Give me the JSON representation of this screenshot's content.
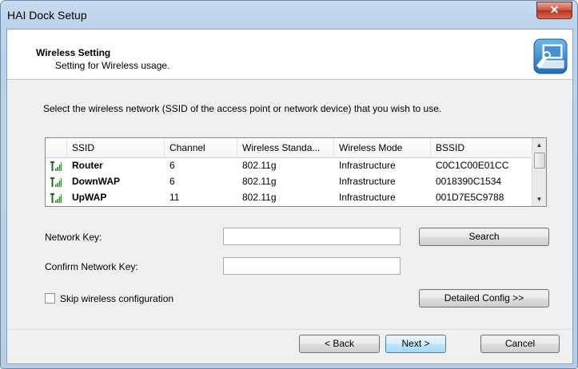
{
  "window": {
    "title": "HAI Dock Setup",
    "close_symbol": "✕"
  },
  "header": {
    "title": "Wireless Setting",
    "subtitle": "Setting for Wireless usage."
  },
  "instruction": "Select the wireless network (SSID of the access point or network device) that you wish to use.",
  "networks": {
    "columns": [
      "SSID",
      "Channel",
      "Wireless Standa...",
      "Wireless Mode",
      "BSSID"
    ],
    "rows": [
      {
        "ssid": "Router",
        "channel": "6",
        "standard": "802.11g",
        "mode": "Infrastructure",
        "bssid": "C0C1C00E01CC"
      },
      {
        "ssid": "DownWAP",
        "channel": "6",
        "standard": "802.11g",
        "mode": "Infrastructure",
        "bssid": "0018390C1534"
      },
      {
        "ssid": "UpWAP",
        "channel": "11",
        "standard": "802.11g",
        "mode": "Infrastructure",
        "bssid": "001D7E5C9788"
      }
    ]
  },
  "form": {
    "network_key_label": "Network Key:",
    "network_key_value": "",
    "confirm_key_label": "Confirm Network Key:",
    "confirm_key_value": "",
    "search_label": "Search",
    "skip_label": "Skip wireless configuration",
    "skip_checked": false,
    "detailed_label": "Detailed Config >>"
  },
  "footer": {
    "back_label": "< Back",
    "next_label": "Next >",
    "cancel_label": "Cancel"
  },
  "colors": {
    "signal_green": "#2e8b2e",
    "signal_bar": "#1a6e1a",
    "close_red": "#c9503f",
    "default_button_border": "#3c7fb1"
  },
  "icons": {
    "signal": "signal-strength-icon",
    "wizard": "network-setup-icon",
    "close": "close-icon"
  }
}
